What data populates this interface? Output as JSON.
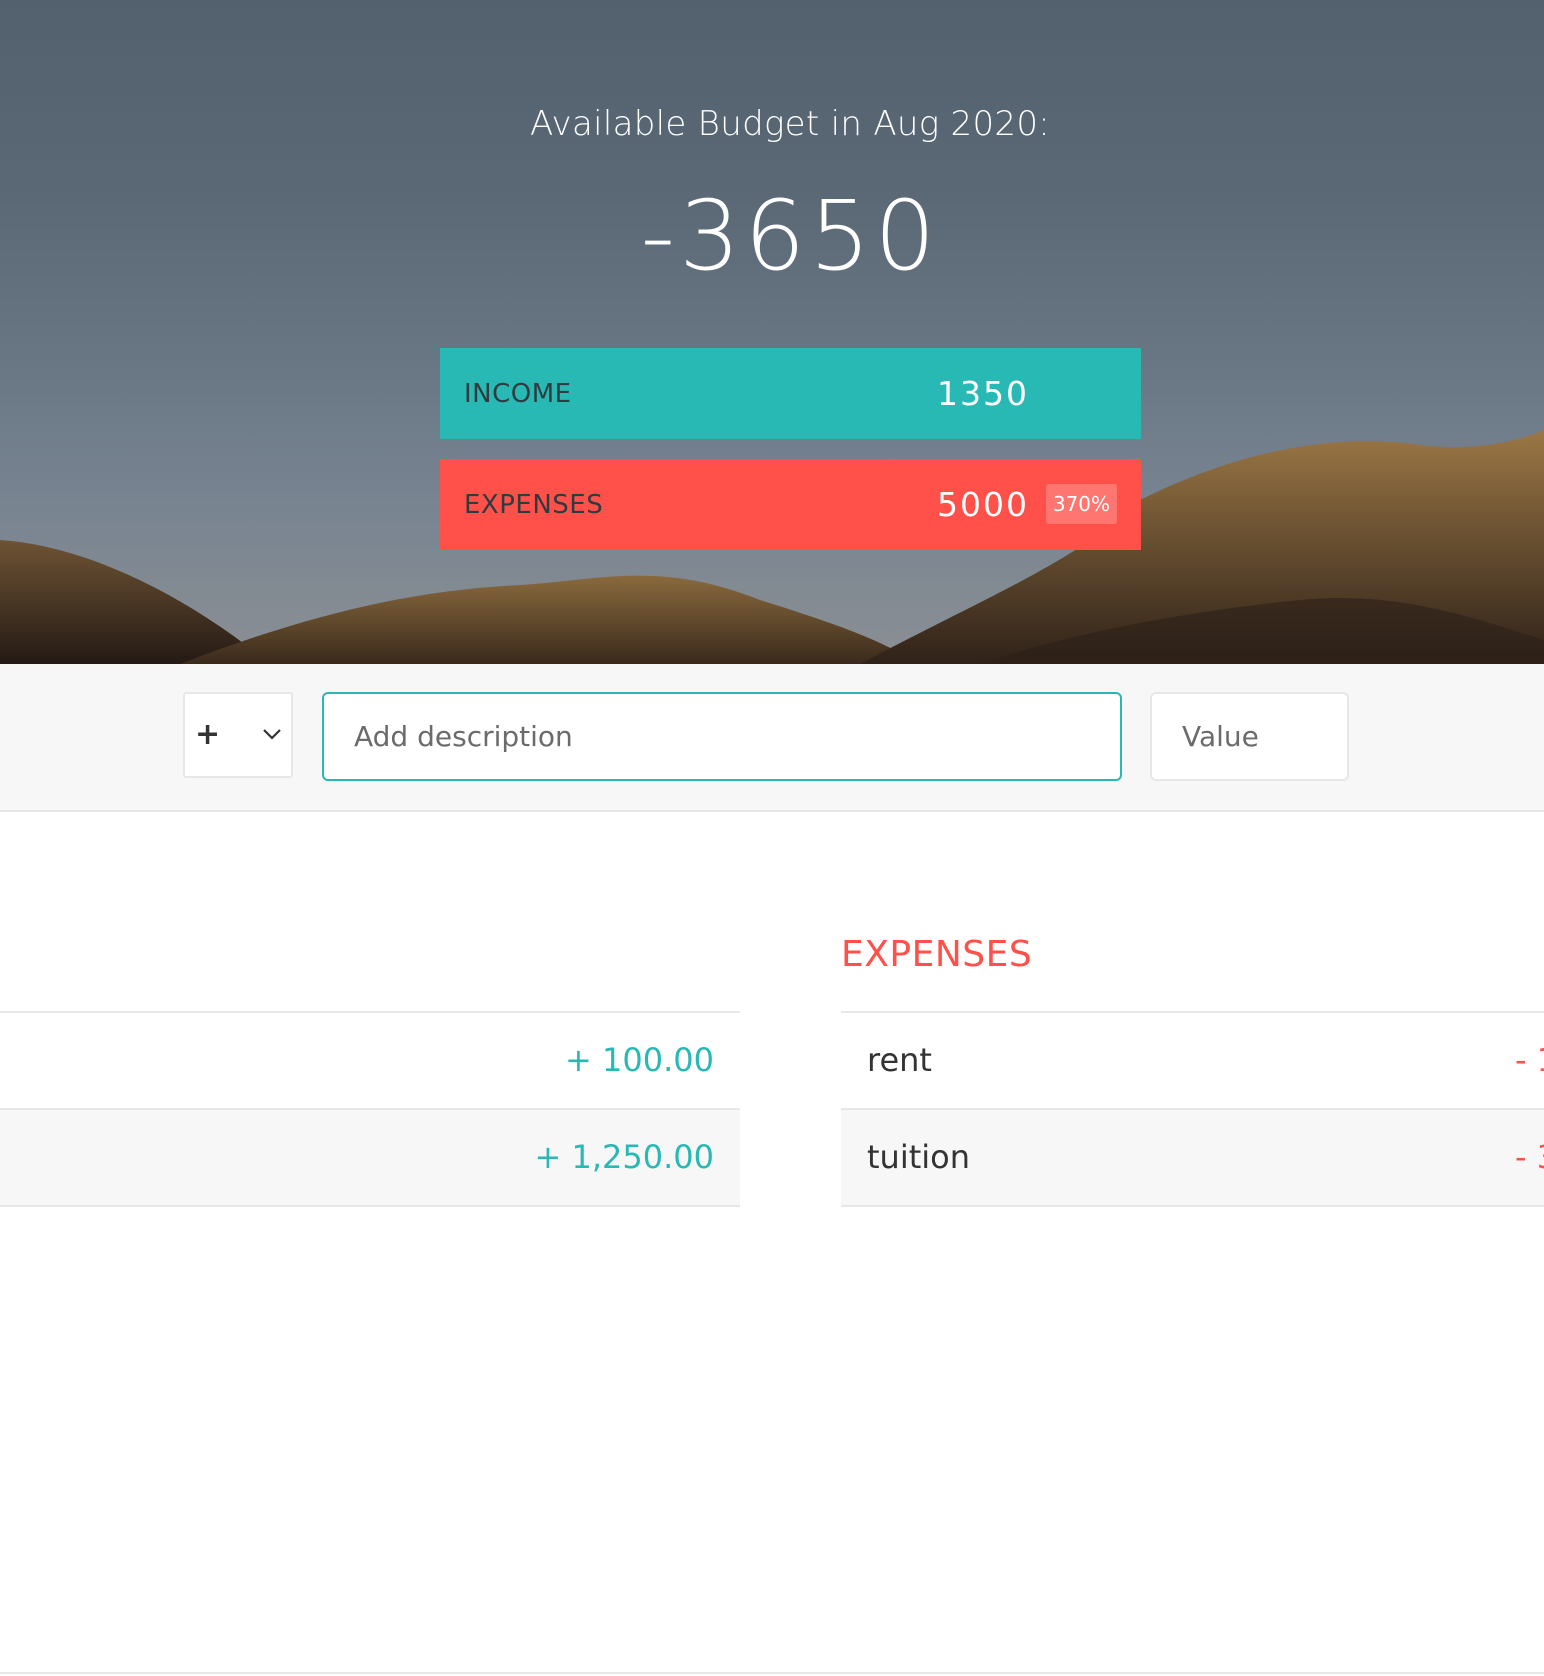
{
  "header": {
    "budget_title": "Available Budget in Aug 2020:",
    "budget_value": "-3650",
    "income": {
      "label": "INCOME",
      "value": "1350"
    },
    "expenses": {
      "label": "EXPENSES",
      "value": "5000",
      "percentage": "370%"
    }
  },
  "add_bar": {
    "type_value": "+",
    "description_placeholder": "Add description",
    "value_placeholder": "Value"
  },
  "lists": {
    "expenses_title": "EXPENSES",
    "income": [
      {
        "description": "",
        "value": "+ 100.00"
      },
      {
        "description": "",
        "value": "+ 1,250.00"
      }
    ],
    "expenses": [
      {
        "description": "rent",
        "value": "- 1"
      },
      {
        "description": "tuition",
        "value": "- 3"
      }
    ]
  },
  "colors": {
    "income_accent": "#28b9b5",
    "expense_accent": "#ff5049",
    "row_alt": "#f7f7f7"
  },
  "icons": {
    "type_select_arrow": "chevron-down-icon"
  }
}
